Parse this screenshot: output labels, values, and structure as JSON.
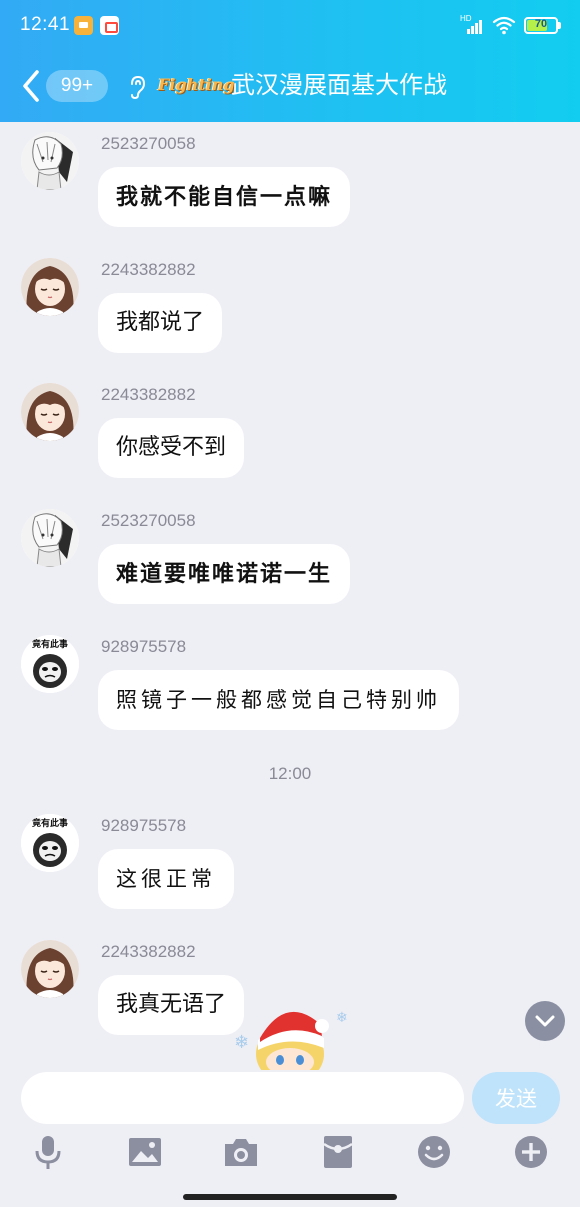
{
  "status_bar": {
    "time": "12:41",
    "network_label": "HD",
    "battery_level": "70",
    "battery_fraction": 0.7,
    "notification_icons": [
      "app-notification-icon",
      "video-app-icon"
    ]
  },
  "header": {
    "back_icon": "chevron-left-icon",
    "unread_count": "99+",
    "ear_icon": "ear-icon",
    "logo_text": "Fighting",
    "title": "武汉漫展面基大作战"
  },
  "messages": [
    {
      "sender": "2523270058",
      "text": "我就不能自信一点嘛",
      "avatar": "anime-girl-avatar",
      "style": "styled"
    },
    {
      "sender": "2243382882",
      "text": "我都说了",
      "avatar": "brown-hair-girl-avatar",
      "style": "plain"
    },
    {
      "sender": "2243382882",
      "text": "你感受不到",
      "avatar": "brown-hair-girl-avatar",
      "style": "plain"
    },
    {
      "sender": "2523270058",
      "text": "难道要唯唯诺诺一生",
      "avatar": "anime-girl-avatar",
      "style": "styled"
    },
    {
      "sender": "928975578",
      "text": "照镜子一般都感觉自己特别帅",
      "avatar": "panda-meme-avatar",
      "style": "airy"
    },
    {
      "divider_time": "12:00"
    },
    {
      "sender": "928975578",
      "text": "这很正常",
      "avatar": "panda-meme-avatar",
      "style": "airy"
    },
    {
      "sender": "2243382882",
      "text": "我真无语了",
      "avatar": "brown-hair-girl-avatar",
      "style": "plain"
    }
  ],
  "avatar_captions": {
    "panda_meme": "竟有此事"
  },
  "input": {
    "placeholder": "",
    "value": "",
    "send_label": "发送"
  },
  "toolbar": [
    "microphone-icon",
    "image-icon",
    "camera-icon",
    "red-packet-icon",
    "emoji-icon",
    "plus-icon"
  ],
  "colors": {
    "header_start": "#33aaf5",
    "header_end": "#12cdf0",
    "background": "#eeeef5",
    "bubble": "#ffffff",
    "send_button": "#bfe3fb",
    "toolbar_icon": "#8c8fa0"
  }
}
